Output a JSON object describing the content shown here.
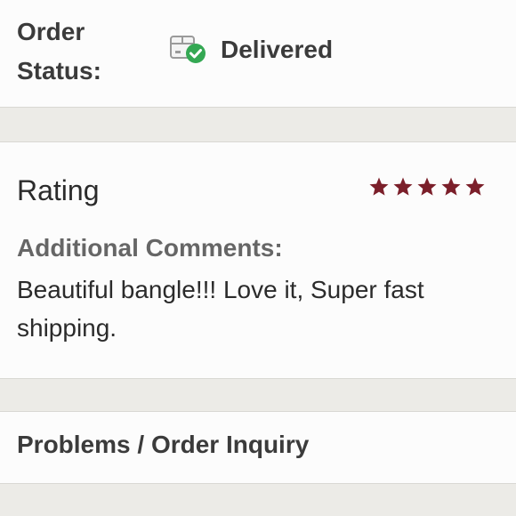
{
  "order_status": {
    "label": "Order Status:",
    "value": "Delivered",
    "icon": "delivered-box-check-icon"
  },
  "rating": {
    "title": "Rating",
    "stars": 5,
    "star_color": "#7b1f2a",
    "comments_label": "Additional Comments:",
    "comments_text": "Beautiful bangle!!! Love it, Super fast shipping."
  },
  "problems": {
    "label": "Problems / Order Inquiry"
  }
}
